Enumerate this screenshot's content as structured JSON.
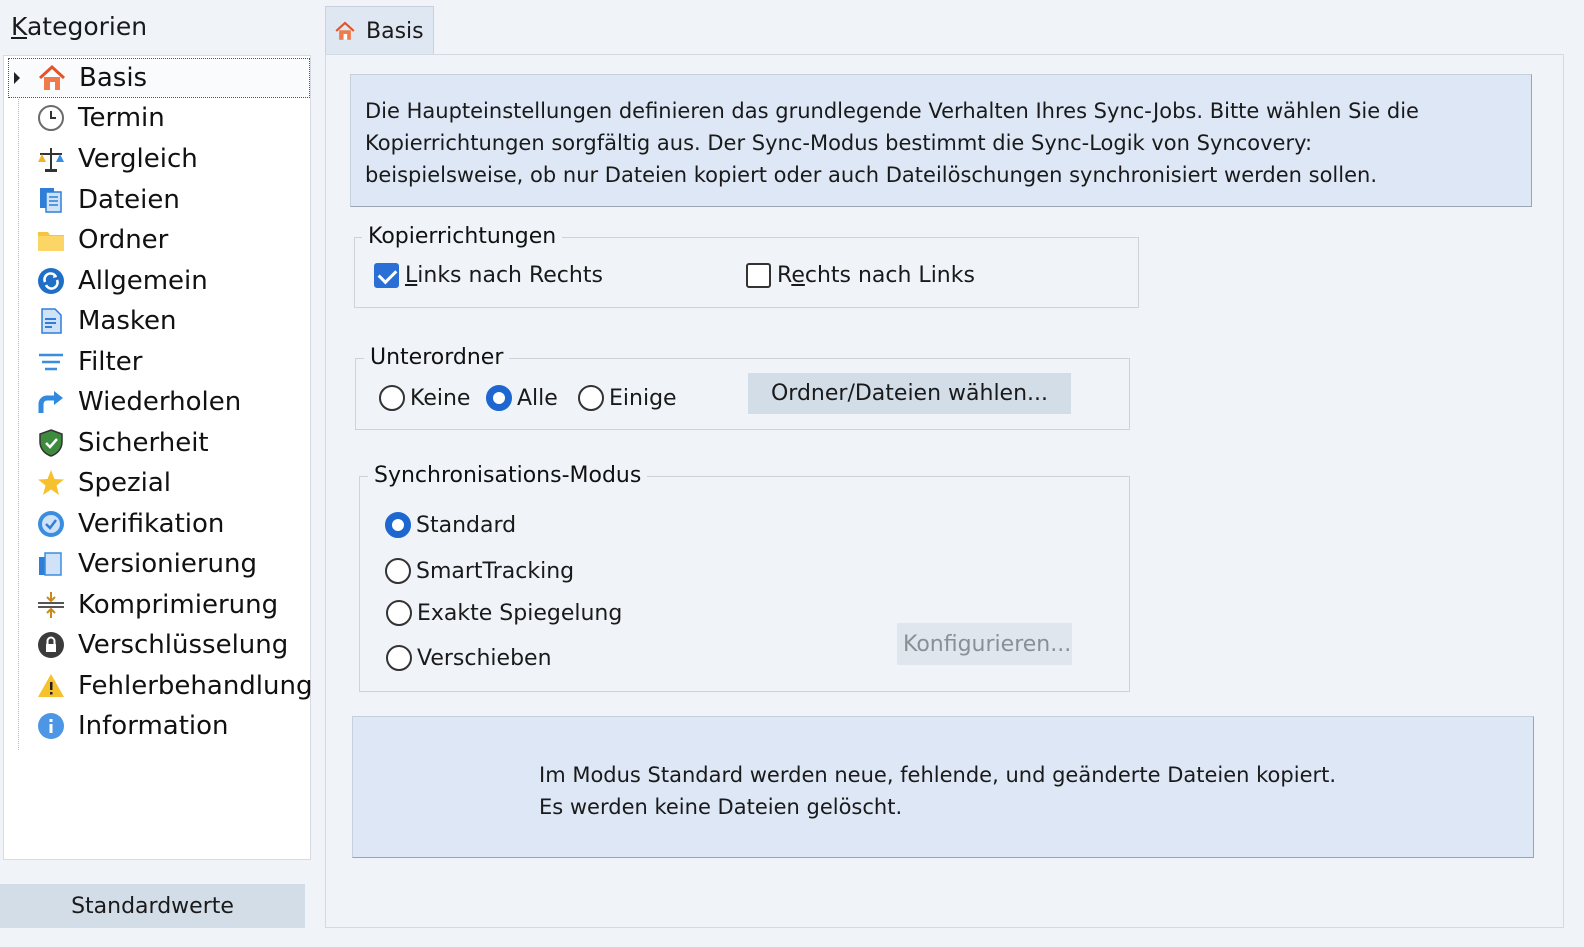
{
  "sidebar": {
    "title": "Kategorien",
    "items": [
      {
        "label": "Basis",
        "icon": "home-icon"
      },
      {
        "label": "Termin",
        "icon": "clock-icon"
      },
      {
        "label": "Vergleich",
        "icon": "scale-icon"
      },
      {
        "label": "Dateien",
        "icon": "files-icon"
      },
      {
        "label": "Ordner",
        "icon": "folder-icon"
      },
      {
        "label": "Allgemein",
        "icon": "sync-icon"
      },
      {
        "label": "Masken",
        "icon": "mask-document-icon"
      },
      {
        "label": "Filter",
        "icon": "filter-icon"
      },
      {
        "label": "Wiederholen",
        "icon": "repeat-arrow-icon"
      },
      {
        "label": "Sicherheit",
        "icon": "shield-icon"
      },
      {
        "label": "Spezial",
        "icon": "star-icon"
      },
      {
        "label": "Verifikation",
        "icon": "check-circle-icon"
      },
      {
        "label": "Versionierung",
        "icon": "versions-icon"
      },
      {
        "label": "Komprimierung",
        "icon": "compress-icon"
      },
      {
        "label": "Verschlüsselung",
        "icon": "lock-icon"
      },
      {
        "label": "Fehlerbehandlung",
        "icon": "warning-icon"
      },
      {
        "label": "Information",
        "icon": "info-icon"
      }
    ],
    "defaults_button": "Standardwerte"
  },
  "tab": {
    "label": "Basis"
  },
  "info_top": {
    "line1": "Die Haupteinstellungen definieren das grundlegende Verhalten Ihres Sync-Jobs. Bitte wählen Sie die",
    "line2": "Kopierrichtungen sorgfältig aus. Der Sync-Modus bestimmt die Sync-Logik von Syncovery:",
    "line3": "beispielsweise, ob nur Dateien kopiert oder auch Dateilöschungen synchronisiert werden sollen."
  },
  "copy_directions": {
    "legend": "Kopierrichtungen",
    "left_to_right": {
      "label": "Links nach Rechts",
      "checked": true
    },
    "right_to_left": {
      "label": "Rechts nach Links",
      "checked": false
    }
  },
  "subfolders": {
    "legend": "Unterordner",
    "options": [
      "Keine",
      "Alle",
      "Einige"
    ],
    "selected": "Alle",
    "choose_button": "Ordner/Dateien wählen..."
  },
  "sync_mode": {
    "legend": "Synchronisations-Modus",
    "options": [
      "Standard",
      "SmartTracking",
      "Exakte Spiegelung",
      "Verschieben"
    ],
    "selected": "Standard",
    "configure_button": "Konfigurieren..."
  },
  "info_bottom": {
    "line1": "Im Modus Standard werden neue, fehlende, und geänderte Dateien kopiert.",
    "line2": "Es werden keine Dateien gelöscht."
  }
}
